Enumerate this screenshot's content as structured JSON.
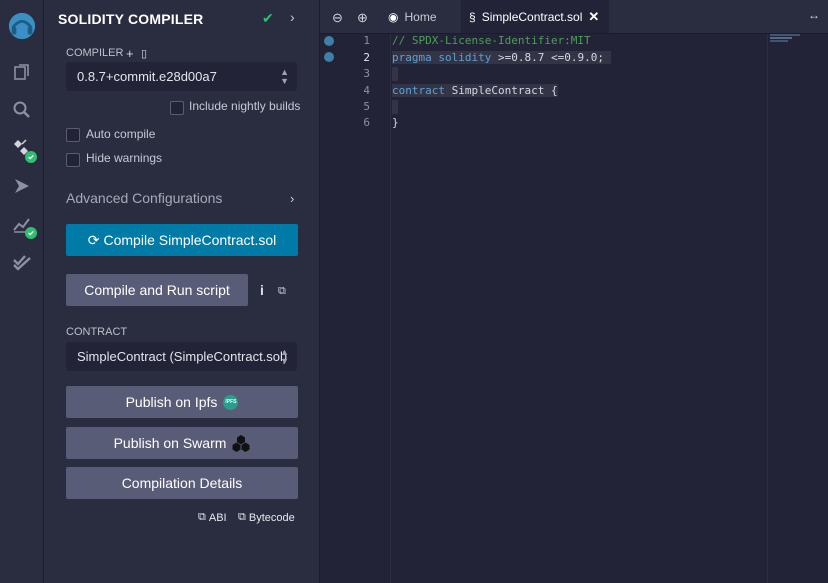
{
  "panel": {
    "title": "SOLIDITY COMPILER",
    "compiler_label": "COMPILER",
    "compiler_version": "0.8.7+commit.e28d00a7",
    "include_nightly": "Include nightly builds",
    "auto_compile": "Auto compile",
    "hide_warnings": "Hide warnings",
    "advanced": "Advanced Configurations",
    "compile_button": "Compile SimpleContract.sol",
    "compile_run_button": "Compile and Run script",
    "contract_label": "CONTRACT",
    "contract_value": "SimpleContract (SimpleContract.sol)",
    "publish_ipfs": "Publish on Ipfs",
    "ipfs_badge": "IPFS",
    "publish_swarm": "Publish on Swarm",
    "compilation_details": "Compilation Details",
    "abi": "ABI",
    "bytecode": "Bytecode"
  },
  "tabs": {
    "home": "Home",
    "active": "SimpleContract.sol"
  },
  "editor": {
    "lines": [
      {
        "num": "1",
        "text": "// SPDX-License-Identifier:MIT"
      },
      {
        "num": "2",
        "kw1": "pragma",
        "kw2": "solidity",
        "rest": ">=0.8.7 <=0.9.0;"
      },
      {
        "num": "3",
        "text": ""
      },
      {
        "num": "4",
        "kw1": "contract",
        "rest": "SimpleContract {"
      },
      {
        "num": "5",
        "text": ""
      },
      {
        "num": "6",
        "text": "}"
      }
    ]
  },
  "colors": {
    "accent": "#007aa6",
    "success": "#2fbf71",
    "panel_bg": "#2a2c3f",
    "editor_bg": "#222336"
  }
}
